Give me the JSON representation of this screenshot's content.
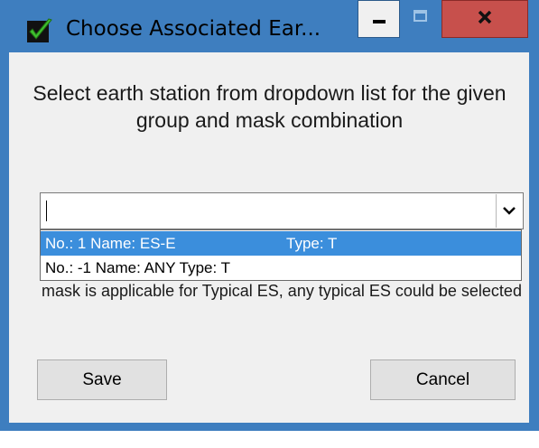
{
  "window": {
    "title": "Choose Associated Ear...",
    "controls": {
      "minimize": "minimize",
      "maximize": "maximize",
      "close": "close"
    },
    "colors": {
      "frame": "#3e7ebf",
      "close": "#c7504c",
      "selection": "#3b8edc"
    }
  },
  "dialog": {
    "message": "Select earth station from dropdown list for the given group and mask combination",
    "combo": {
      "value": "",
      "icon": "chevron-down-icon"
    },
    "dropdown_items": [
      {
        "label": "No.:  1 Name: ES-E",
        "type": "Type: T",
        "selected": true
      },
      {
        "label": "No.: -1 Name: ANY Type: T",
        "type": "",
        "selected": false
      }
    ],
    "note": "mask is applicable for Typical ES, any typical ES could be selected",
    "save_label": "Save",
    "cancel_label": "Cancel"
  }
}
